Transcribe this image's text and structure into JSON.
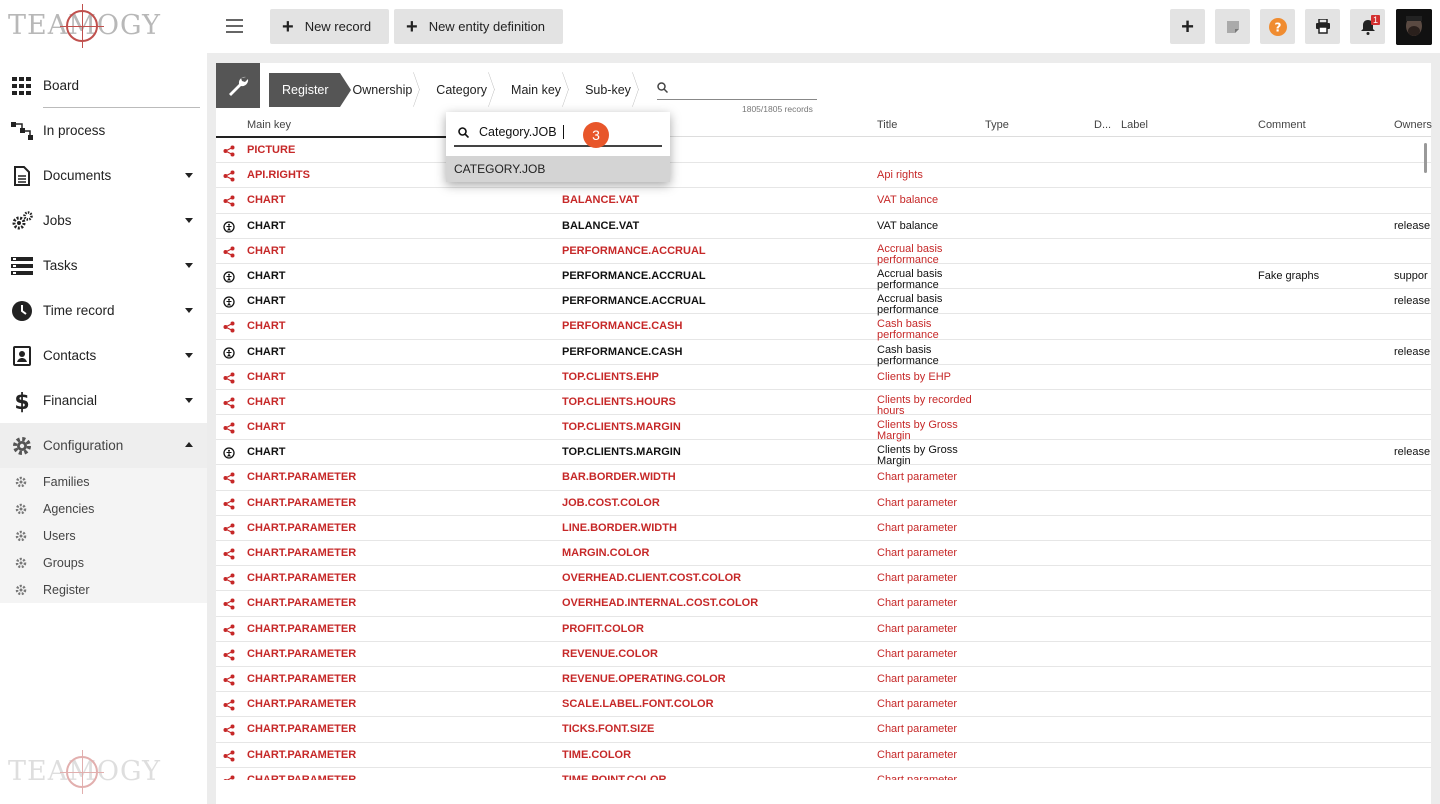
{
  "brand": {
    "logo_text": "TEAMOGY",
    "accent": "#c62828"
  },
  "sidebar": {
    "items": [
      {
        "label": "Board",
        "icon": "grid-icon",
        "expandable": false
      },
      {
        "label": "In process",
        "icon": "flow-icon",
        "expandable": false
      },
      {
        "label": "Documents",
        "icon": "document-icon",
        "expandable": true
      },
      {
        "label": "Jobs",
        "icon": "gears-icon",
        "expandable": true
      },
      {
        "label": "Tasks",
        "icon": "tasks-icon",
        "expandable": true
      },
      {
        "label": "Time record",
        "icon": "clock-icon",
        "expandable": true
      },
      {
        "label": "Contacts",
        "icon": "contacts-icon",
        "expandable": true
      },
      {
        "label": "Financial",
        "icon": "dollar-icon",
        "expandable": true
      },
      {
        "label": "Configuration",
        "icon": "gear-icon",
        "expandable": true
      }
    ],
    "configuration_sub": [
      "Families",
      "Agencies",
      "Users",
      "Groups",
      "Register"
    ]
  },
  "topbar": {
    "new_record_label": "New record",
    "new_entity_label": "New entity definition",
    "notification_count": "1"
  },
  "register": {
    "breadcrumbs": [
      "Register",
      "Ownership",
      "Category",
      "Main key",
      "Sub-key"
    ],
    "search_value": "",
    "record_count": "1805/1805 records",
    "columns": [
      "Main key",
      "Title",
      "Type",
      "D...",
      "Label",
      "Comment",
      "Owners"
    ],
    "rows": [
      {
        "kind": "red",
        "icon": "share-icon",
        "category": "PICTURE",
        "main_key": "",
        "title": "",
        "comment": "",
        "owner": ""
      },
      {
        "kind": "red",
        "icon": "share-icon",
        "category": "API.RIGHTS",
        "main_key": "",
        "title": "Api rights",
        "comment": "",
        "owner": ""
      },
      {
        "kind": "red",
        "icon": "share-icon",
        "category": "CHART",
        "main_key": "BALANCE.VAT",
        "title": "VAT balance",
        "comment": "",
        "owner": ""
      },
      {
        "kind": "blk",
        "icon": "ownership-icon",
        "category": "CHART",
        "main_key": "BALANCE.VAT",
        "title": "VAT balance",
        "comment": "",
        "owner": "release"
      },
      {
        "kind": "red",
        "icon": "share-icon",
        "category": "CHART",
        "main_key": "PERFORMANCE.ACCRUAL",
        "title": "Accrual basis performance",
        "comment": "",
        "owner": ""
      },
      {
        "kind": "blk",
        "icon": "ownership-icon",
        "category": "CHART",
        "main_key": "PERFORMANCE.ACCRUAL",
        "title": "Accrual basis performance",
        "comment": "Fake graphs",
        "owner": "suppor"
      },
      {
        "kind": "blk",
        "icon": "ownership-icon",
        "category": "CHART",
        "main_key": "PERFORMANCE.ACCRUAL",
        "title": "Accrual basis performance",
        "comment": "",
        "owner": "release"
      },
      {
        "kind": "red",
        "icon": "share-icon",
        "category": "CHART",
        "main_key": "PERFORMANCE.CASH",
        "title": "Cash basis performance",
        "comment": "",
        "owner": ""
      },
      {
        "kind": "blk",
        "icon": "ownership-icon",
        "category": "CHART",
        "main_key": "PERFORMANCE.CASH",
        "title": "Cash basis performance",
        "comment": "",
        "owner": "release"
      },
      {
        "kind": "red",
        "icon": "share-icon",
        "category": "CHART",
        "main_key": "TOP.CLIENTS.EHP",
        "title": "Clients by EHP",
        "comment": "",
        "owner": ""
      },
      {
        "kind": "red",
        "icon": "share-icon",
        "category": "CHART",
        "main_key": "TOP.CLIENTS.HOURS",
        "title": "Clients by recorded hours",
        "comment": "",
        "owner": ""
      },
      {
        "kind": "red",
        "icon": "share-icon",
        "category": "CHART",
        "main_key": "TOP.CLIENTS.MARGIN",
        "title": "Clients by Gross Margin",
        "comment": "",
        "owner": ""
      },
      {
        "kind": "blk",
        "icon": "ownership-icon",
        "category": "CHART",
        "main_key": "TOP.CLIENTS.MARGIN",
        "title": "Clients by Gross Margin",
        "comment": "",
        "owner": "release"
      },
      {
        "kind": "red",
        "icon": "share-icon",
        "category": "CHART.PARAMETER",
        "main_key": "BAR.BORDER.WIDTH",
        "title": "Chart parameter",
        "comment": "",
        "owner": ""
      },
      {
        "kind": "red",
        "icon": "share-icon",
        "category": "CHART.PARAMETER",
        "main_key": "JOB.COST.COLOR",
        "title": "Chart parameter",
        "comment": "",
        "owner": ""
      },
      {
        "kind": "red",
        "icon": "share-icon",
        "category": "CHART.PARAMETER",
        "main_key": "LINE.BORDER.WIDTH",
        "title": "Chart parameter",
        "comment": "",
        "owner": ""
      },
      {
        "kind": "red",
        "icon": "share-icon",
        "category": "CHART.PARAMETER",
        "main_key": "MARGIN.COLOR",
        "title": "Chart parameter",
        "comment": "",
        "owner": ""
      },
      {
        "kind": "red",
        "icon": "share-icon",
        "category": "CHART.PARAMETER",
        "main_key": "OVERHEAD.CLIENT.COST.COLOR",
        "title": "Chart parameter",
        "comment": "",
        "owner": ""
      },
      {
        "kind": "red",
        "icon": "share-icon",
        "category": "CHART.PARAMETER",
        "main_key": "OVERHEAD.INTERNAL.COST.COLOR",
        "title": "Chart parameter",
        "comment": "",
        "owner": ""
      },
      {
        "kind": "red",
        "icon": "share-icon",
        "category": "CHART.PARAMETER",
        "main_key": "PROFIT.COLOR",
        "title": "Chart parameter",
        "comment": "",
        "owner": ""
      },
      {
        "kind": "red",
        "icon": "share-icon",
        "category": "CHART.PARAMETER",
        "main_key": "REVENUE.COLOR",
        "title": "Chart parameter",
        "comment": "",
        "owner": ""
      },
      {
        "kind": "red",
        "icon": "share-icon",
        "category": "CHART.PARAMETER",
        "main_key": "REVENUE.OPERATING.COLOR",
        "title": "Chart parameter",
        "comment": "",
        "owner": ""
      },
      {
        "kind": "red",
        "icon": "share-icon",
        "category": "CHART.PARAMETER",
        "main_key": "SCALE.LABEL.FONT.COLOR",
        "title": "Chart parameter",
        "comment": "",
        "owner": ""
      },
      {
        "kind": "red",
        "icon": "share-icon",
        "category": "CHART.PARAMETER",
        "main_key": "TICKS.FONT.SIZE",
        "title": "Chart parameter",
        "comment": "",
        "owner": ""
      },
      {
        "kind": "red",
        "icon": "share-icon",
        "category": "CHART.PARAMETER",
        "main_key": "TIME.COLOR",
        "title": "Chart parameter",
        "comment": "",
        "owner": ""
      },
      {
        "kind": "red",
        "icon": "share-icon",
        "category": "CHART.PARAMETER",
        "main_key": "TIME.POINT.COLOR",
        "title": "Chart parameter",
        "comment": "",
        "owner": ""
      }
    ]
  },
  "dropdown": {
    "input_value": "Category.JOB",
    "badge": "3",
    "option": "CATEGORY.JOB"
  }
}
